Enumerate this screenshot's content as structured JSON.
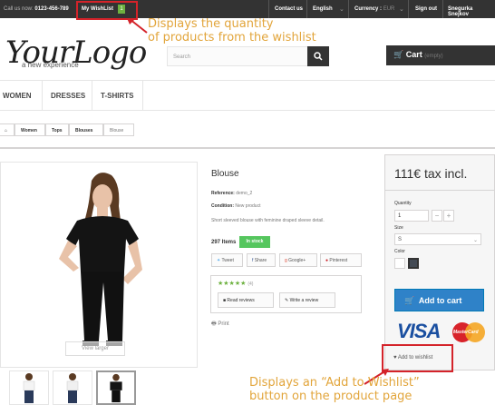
{
  "topbar": {
    "call_prefix": "Call us now:",
    "phone": "0123-456-789",
    "wishlist_label": "My WishList",
    "wishlist_count": "1",
    "contact": "Contact us",
    "language": "English",
    "currency_label": "Currency :",
    "currency_value": "EUR",
    "signout": "Sign out",
    "username": "Snegurka Snejkov"
  },
  "annotations": {
    "top_line1": "Displays the quantity",
    "top_line2": "of products from the wishlist",
    "bottom_line1": "Displays an “Add to Wishlist”",
    "bottom_line2": "button on the product page",
    "color": "#d4232a"
  },
  "header": {
    "logo": "YourLogo",
    "logo_tagline": "a new experience",
    "search_placeholder": "Search",
    "cart_label": "Cart",
    "cart_status": "(empty)"
  },
  "nav": {
    "items": [
      {
        "label": "WOMEN"
      },
      {
        "label": "DRESSES"
      },
      {
        "label": "T-SHIRTS"
      }
    ]
  },
  "breadcrumb": [
    "Women",
    "Tops",
    "Blouses",
    "Blouse"
  ],
  "product": {
    "title": "Blouse",
    "reference_label": "Reference:",
    "reference": "demo_2",
    "condition_label": "Condition:",
    "condition": "New product",
    "description": "Short sleeved blouse with feminine draped sleeve detail.",
    "items_count": "297 Items",
    "stock": "In stock",
    "share": [
      "Tweet",
      "Share",
      "Google+",
      "Pinterest"
    ],
    "stars": "★★★★★",
    "review_count": "(4)",
    "read_reviews": "Read reviews",
    "write_review": "Write a review",
    "print": "Print",
    "view_larger": "View larger"
  },
  "buybox": {
    "price": "111€ tax incl.",
    "quantity_label": "Quantity",
    "quantity_value": "1",
    "size_label": "Size",
    "size_value": "S",
    "color_label": "Color",
    "colors": [
      "#ffffff",
      "#434a54"
    ],
    "add_to_cart": "Add to cart",
    "payment_visa": "VISA",
    "payment_mc": "MasterCard",
    "add_to_wishlist": "Add to wishlist"
  }
}
